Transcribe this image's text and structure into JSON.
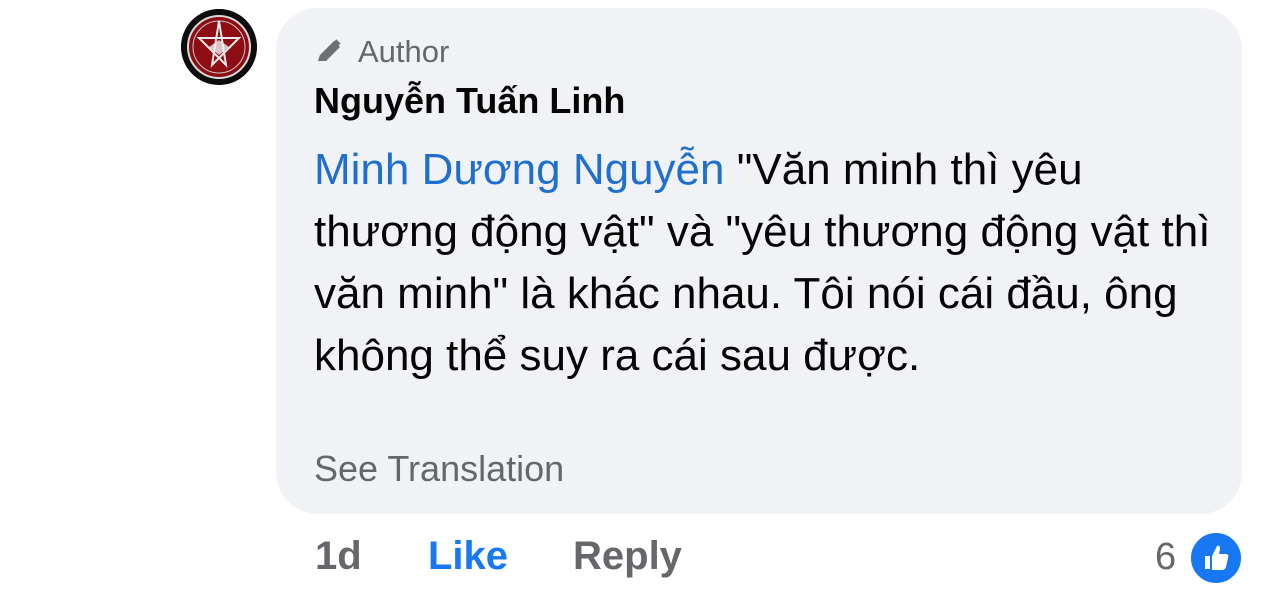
{
  "comment": {
    "badge_label": "Author",
    "author_name": "Nguyễn Tuấn Linh",
    "mention": "Minh Dương Nguyễn",
    "text": " \"Văn minh thì yêu thương động vật\" và \"yêu thương động vật thì văn minh\" là khác nhau. Tôi nói cái đầu, ông không thể suy ra cái sau được.",
    "see_translation": "See Translation"
  },
  "actions": {
    "time": "1d",
    "like": "Like",
    "reply": "Reply"
  },
  "reactions": {
    "count": "6",
    "icon": "like-icon",
    "color": "#1877f2"
  },
  "avatar": {
    "icon": "pentagram-icon",
    "color": "#b3131b"
  }
}
